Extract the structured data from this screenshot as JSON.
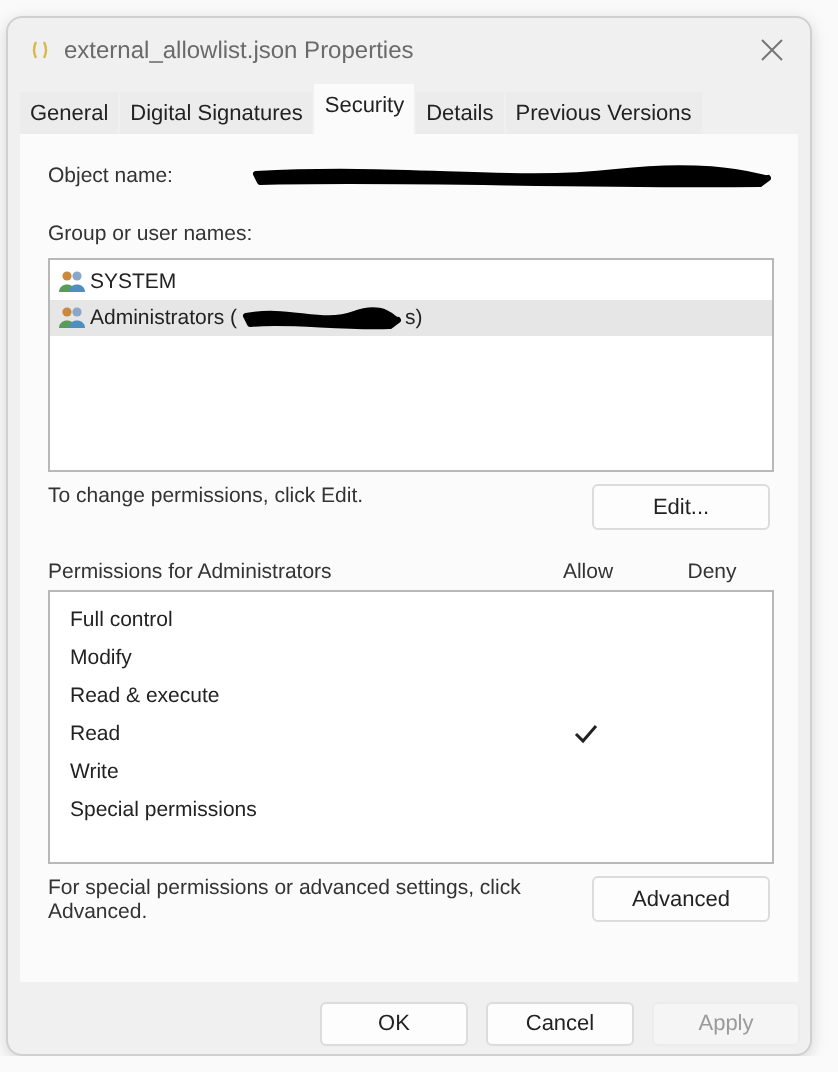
{
  "window": {
    "title": "external_allowlist.json Properties"
  },
  "tabs": [
    {
      "label": "General",
      "selected": false
    },
    {
      "label": "Digital Signatures",
      "selected": false
    },
    {
      "label": "Security",
      "selected": true
    },
    {
      "label": "Details",
      "selected": false
    },
    {
      "label": "Previous Versions",
      "selected": false
    }
  ],
  "object_name": {
    "label": "Object name:",
    "redacted": true
  },
  "groups": {
    "label": "Group or user names:",
    "items": [
      {
        "name": "SYSTEM",
        "selected": false,
        "redacted": false
      },
      {
        "name": "Administrators (",
        "suffix": "s)",
        "selected": true,
        "redacted": true
      }
    ]
  },
  "edit_hint": "To change permissions, click Edit.",
  "edit_button": "Edit...",
  "permissions": {
    "label": "Permissions for Administrators",
    "allow_label": "Allow",
    "deny_label": "Deny",
    "rows": [
      {
        "name": "Full control",
        "allow": false,
        "deny": false
      },
      {
        "name": "Modify",
        "allow": false,
        "deny": false
      },
      {
        "name": "Read & execute",
        "allow": false,
        "deny": false
      },
      {
        "name": "Read",
        "allow": true,
        "deny": false
      },
      {
        "name": "Write",
        "allow": false,
        "deny": false
      },
      {
        "name": "Special permissions",
        "allow": false,
        "deny": false
      }
    ]
  },
  "advanced_hint": "For special permissions or advanced settings, click Advanced.",
  "advanced_button": "Advanced",
  "buttons": [
    {
      "label": "OK",
      "disabled": false
    },
    {
      "label": "Cancel",
      "disabled": false
    },
    {
      "label": "Apply",
      "disabled": true
    }
  ]
}
